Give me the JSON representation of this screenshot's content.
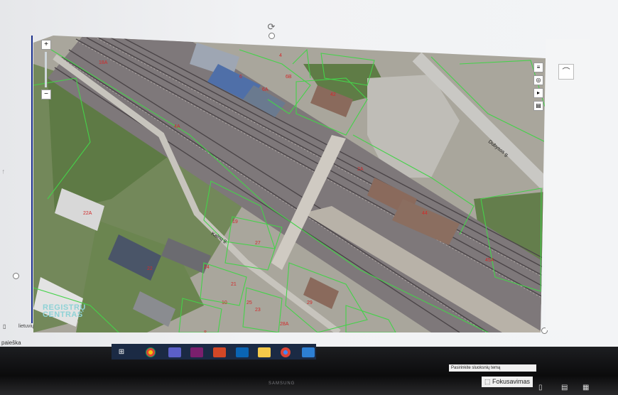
{
  "app": {
    "language": "lietuvių",
    "left_fragment": "paieška",
    "left_marker": "ᛏ",
    "layer_tooltip": "Pasirinkite sluoksnių temą",
    "focus_mode": "Fokusavimas",
    "watermark_line1": "REGISTRŲ",
    "watermark_line2": "CENTRAS",
    "monitor_brand": "SAMSUNG"
  },
  "map": {
    "street_labels": [
      {
        "text": "Kalnų g.",
        "id": "street-kalnu"
      },
      {
        "text": "Dubysos g.",
        "id": "street-dubysos"
      }
    ],
    "parcel_labels": [
      "18A",
      "6",
      "6A",
      "6B",
      "42",
      "4",
      "2A",
      "44",
      "27",
      "22A",
      "22",
      "24",
      "29",
      "21",
      "28A",
      "29A",
      "45A",
      "19",
      "10",
      "25",
      "4A",
      "8",
      "23"
    ],
    "colors": {
      "parcel_border": "#45d24a",
      "parcel_label": "#d12a2a",
      "rail": "#5a5457",
      "vegetation": "#6f8a55",
      "platform": "#8a8d93",
      "roof_brown": "#8a6a5c",
      "roof_blue": "#4f6fa8"
    }
  },
  "toolbar": {
    "zoom_in": "+",
    "zoom_out": "−",
    "tool_icons": [
      "layers-icon",
      "locate-icon",
      "measure-icon",
      "print-icon"
    ]
  },
  "taskbar": {
    "icons": [
      "task-view-icon",
      "chrome-icon",
      "teams-icon",
      "powerpoint-icon",
      "outlook-icon",
      "file-explorer-icon",
      "chrome-alt-icon",
      "settings-icon"
    ]
  }
}
